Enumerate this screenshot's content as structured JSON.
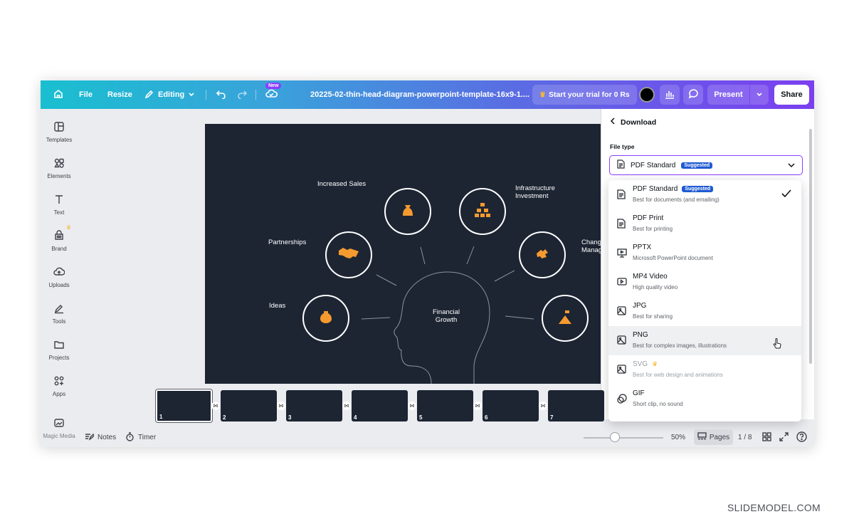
{
  "topbar": {
    "file": "File",
    "resize": "Resize",
    "editing": "Editing",
    "new_badge": "New",
    "doc_title": "20225-02-thin-head-diagram-powerpoint-template-16x9-1....",
    "trial": "Start your trial for 0 Rs",
    "present": "Present",
    "share": "Share"
  },
  "sidebar": {
    "items": [
      {
        "label": "Templates",
        "icon": "templates-icon"
      },
      {
        "label": "Elements",
        "icon": "elements-icon"
      },
      {
        "label": "Text",
        "icon": "text-icon"
      },
      {
        "label": "Brand",
        "icon": "brand-icon"
      },
      {
        "label": "Uploads",
        "icon": "uploads-icon"
      },
      {
        "label": "Tools",
        "icon": "tools-icon"
      },
      {
        "label": "Projects",
        "icon": "projects-icon"
      },
      {
        "label": "Apps",
        "icon": "apps-icon"
      },
      {
        "label": "Magic Media",
        "icon": "magic-media-icon"
      }
    ]
  },
  "slide": {
    "center": "Financial\nGrowth",
    "labels": {
      "increased_sales": "Increased Sales",
      "infrastructure": "Infrastructure\nInvestment",
      "partnerships": "Partnerships",
      "change": "Chang\nManag",
      "ideas": "Ideas"
    }
  },
  "download": {
    "title": "Download",
    "file_type_label": "File type",
    "selected": "PDF Standard",
    "suggested": "Suggested",
    "options": [
      {
        "name": "PDF Standard",
        "desc": "Best for documents (and emailing)",
        "badge": "Suggested",
        "checked": true
      },
      {
        "name": "PDF Print",
        "desc": "Best for printing"
      },
      {
        "name": "PPTX",
        "desc": "Microsoft PowerPoint document"
      },
      {
        "name": "MP4 Video",
        "desc": "High quality video"
      },
      {
        "name": "JPG",
        "desc": "Best for sharing"
      },
      {
        "name": "PNG",
        "desc": "Best for complex images, illustrations",
        "hovered": true
      },
      {
        "name": "SVG",
        "desc": "Best for web design and animations",
        "premium": true
      },
      {
        "name": "GIF",
        "desc": "Short clip, no sound"
      }
    ]
  },
  "pages": {
    "thumb_numbers": [
      "1",
      "2",
      "3",
      "4",
      "5",
      "6",
      "7"
    ]
  },
  "bottombar": {
    "notes": "Notes",
    "timer": "Timer",
    "zoom": "50%",
    "pages": "Pages",
    "page_count": "1 / 8"
  },
  "watermark": "SLIDEMODEL.COM",
  "colors": {
    "accent": "#8b3dff",
    "slide_bg": "#1d2533",
    "icon_orange": "#f59a2f",
    "suggested_badge": "#1f5ad3"
  }
}
